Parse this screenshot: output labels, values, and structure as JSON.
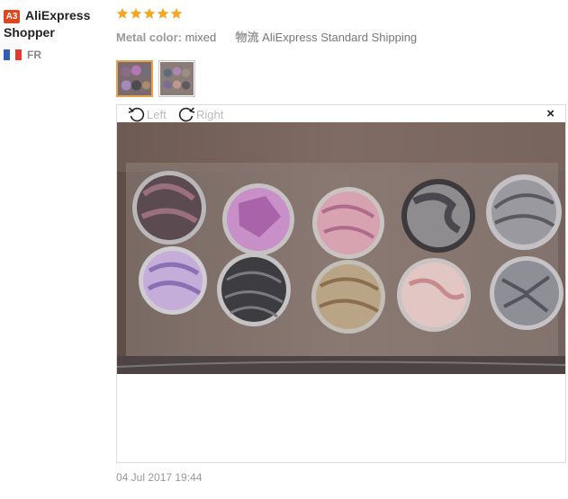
{
  "user": {
    "avatar": "A3",
    "name_line1": "AliExpress",
    "name_line2": "Shopper",
    "country": "FR",
    "flag_colors": [
      "#2f5db8",
      "#ffffff",
      "#e03c31"
    ]
  },
  "review": {
    "rating": 5,
    "star_color": "#f5a623",
    "attr1_key": "Metal color:",
    "attr1_val": "mixed",
    "attr2_key": "物流",
    "attr2_val": "AliExpress Standard Shipping",
    "thumbnails": [
      {
        "name": "photo-1",
        "active": true
      },
      {
        "name": "photo-2",
        "active": false
      }
    ]
  },
  "viewer": {
    "rotate_left_label": "Left",
    "rotate_right_label": "Right",
    "close_label": "×",
    "rotate_left_icon": "rotate-ccw-icon",
    "rotate_right_icon": "rotate-cw-icon",
    "close_icon": "close-icon"
  },
  "date": "04 Jul 2017 19:44"
}
